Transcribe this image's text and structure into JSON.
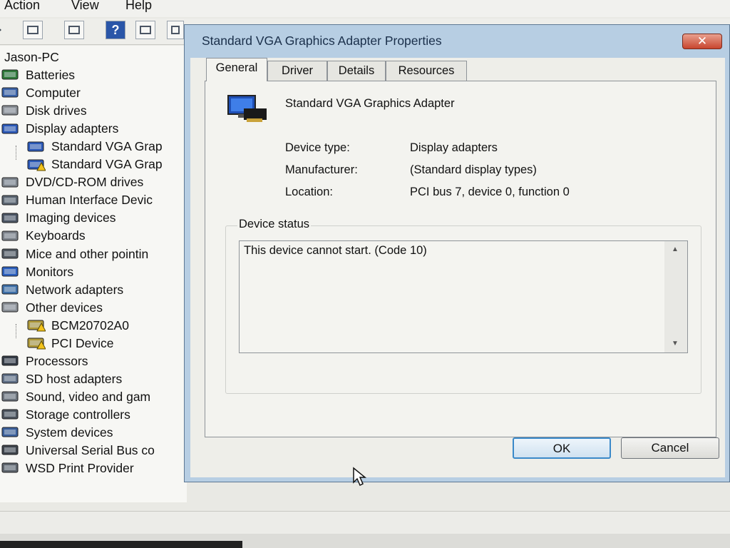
{
  "menu": [
    "Action",
    "View",
    "Help"
  ],
  "tree": {
    "root": "Jason-PC",
    "items": [
      {
        "label": "Batteries",
        "icon": "battery-icon",
        "level": 1
      },
      {
        "label": "Computer",
        "icon": "computer-icon",
        "level": 1
      },
      {
        "label": "Disk drives",
        "icon": "disk-drive-icon",
        "level": 1
      },
      {
        "label": "Display adapters",
        "icon": "display-adapter-icon",
        "level": 1
      },
      {
        "label": "Standard VGA Grap",
        "icon": "display-adapter-icon",
        "level": 2
      },
      {
        "label": "Standard VGA Grap",
        "icon": "display-adapter-warning-icon",
        "level": 2
      },
      {
        "label": "DVD/CD-ROM drives",
        "icon": "dvd-drive-icon",
        "level": 1
      },
      {
        "label": "Human Interface Devic",
        "icon": "hid-icon",
        "level": 1
      },
      {
        "label": "Imaging devices",
        "icon": "camera-icon",
        "level": 1
      },
      {
        "label": "Keyboards",
        "icon": "keyboard-icon",
        "level": 1
      },
      {
        "label": "Mice and other pointin",
        "icon": "mouse-icon",
        "level": 1
      },
      {
        "label": "Monitors",
        "icon": "monitor-icon",
        "level": 1
      },
      {
        "label": "Network adapters",
        "icon": "network-icon",
        "level": 1
      },
      {
        "label": "Other devices",
        "icon": "other-devices-icon",
        "level": 1
      },
      {
        "label": "BCM20702A0",
        "icon": "unknown-device-warning-icon",
        "level": 2
      },
      {
        "label": "PCI Device",
        "icon": "unknown-device-warning-icon",
        "level": 2
      },
      {
        "label": "Processors",
        "icon": "processor-icon",
        "level": 1
      },
      {
        "label": "SD host adapters",
        "icon": "sd-card-icon",
        "level": 1
      },
      {
        "label": "Sound, video and gam",
        "icon": "speaker-icon",
        "level": 1
      },
      {
        "label": "Storage controllers",
        "icon": "storage-controller-icon",
        "level": 1
      },
      {
        "label": "System devices",
        "icon": "system-devices-icon",
        "level": 1
      },
      {
        "label": "Universal Serial Bus co",
        "icon": "usb-icon",
        "level": 1
      },
      {
        "label": "WSD Print Provider",
        "icon": "printer-icon",
        "level": 1
      }
    ]
  },
  "dialog": {
    "title": "Standard VGA Graphics Adapter Properties",
    "close_label": "✕",
    "tabs": [
      "General",
      "Driver",
      "Details",
      "Resources"
    ],
    "active_tab": "General",
    "device_name": "Standard VGA Graphics Adapter",
    "properties": [
      {
        "label": "Device type:",
        "value": "Display adapters"
      },
      {
        "label": "Manufacturer:",
        "value": "(Standard display types)"
      },
      {
        "label": "Location:",
        "value": "PCI bus 7, device 0, function 0"
      }
    ],
    "status_group_label": "Device status",
    "status_text": "This device cannot start. (Code 10)",
    "buttons": {
      "ok": "OK",
      "cancel": "Cancel"
    }
  },
  "colors": {
    "dialog_frame": "#b7cee3",
    "close_button": "#c8452e",
    "ok_border": "#3a89c9"
  }
}
